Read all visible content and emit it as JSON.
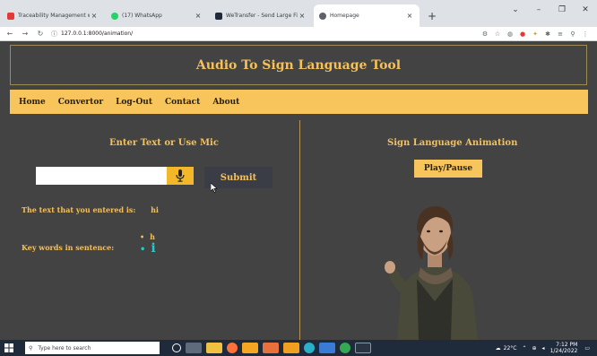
{
  "browser": {
    "tabs": [
      {
        "title": "Traceability Management with In",
        "color": "#e53935"
      },
      {
        "title": "(17) WhatsApp",
        "color": "#25d366"
      },
      {
        "title": "WeTransfer - Send Large Files & S",
        "color": "#1f2a3a"
      },
      {
        "title": "Homepage",
        "color": "#5f6368"
      }
    ],
    "url": "127.0.0.1:8000/animation/"
  },
  "header": {
    "title": "Audio To Sign Language Tool"
  },
  "nav": {
    "items": [
      "Home",
      "Convertor",
      "Log-Out",
      "Contact",
      "About"
    ]
  },
  "left": {
    "title": "Enter Text or Use Mic",
    "input_value": "",
    "submit_label": "Submit",
    "entered_label": "The text that you entered is:",
    "entered_value": "hi",
    "keywords_label": "Key words in sentence:",
    "keywords": [
      "h",
      "i"
    ]
  },
  "right": {
    "title": "Sign Language Animation",
    "play_label": "Play/Pause"
  },
  "taskbar": {
    "search_placeholder": "Type here to search",
    "weather": "22°C",
    "time": "7:12 PM",
    "date": "1/24/2022"
  }
}
